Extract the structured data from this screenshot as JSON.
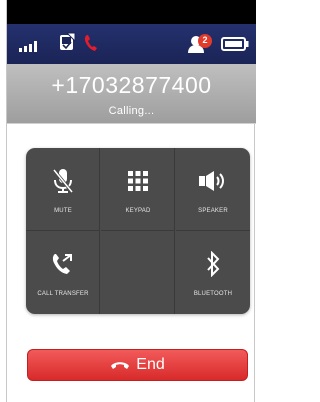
{
  "status_bar": {
    "icons": [
      "signal-icon",
      "voicemail-icon",
      "phone-icon",
      "contact-notification-icon",
      "battery-icon"
    ],
    "notification_count": "2",
    "colors": {
      "background": "#1b2456",
      "phone_icon": "#e21d2c",
      "badge": "#e23b2c"
    }
  },
  "call": {
    "number": "+17032877400",
    "status": "Calling..."
  },
  "keypad": {
    "buttons": [
      {
        "label": "MUTE",
        "icon": "microphone-muted-icon"
      },
      {
        "label": "KEYPAD",
        "icon": "keypad-grid-icon"
      },
      {
        "label": "SPEAKER",
        "icon": "speaker-icon"
      },
      {
        "label": "CALL TRANSFER",
        "icon": "call-transfer-icon"
      },
      {
        "label": "",
        "icon": ""
      },
      {
        "label": "BLUETOOTH",
        "icon": "bluetooth-icon"
      }
    ],
    "colors": {
      "panel": "#4b4b4b"
    }
  },
  "end_button": {
    "label": "End",
    "icon": "hang-up-icon",
    "color": "#e23a3a"
  }
}
